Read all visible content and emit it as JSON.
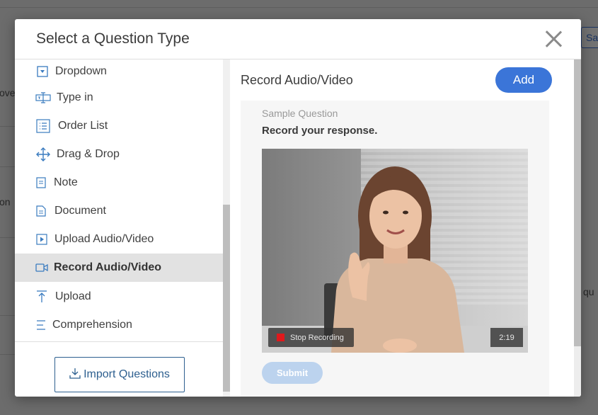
{
  "background": {
    "fragments": [
      "ove",
      "on",
      "Sa",
      "qu"
    ]
  },
  "modal": {
    "title": "Select a Question Type",
    "close_icon": "close-icon"
  },
  "question_types": [
    {
      "label": "Dropdown",
      "icon": "dropdown-icon"
    },
    {
      "label": "Type in",
      "icon": "type-in-icon"
    },
    {
      "label": "Order List",
      "icon": "order-list-icon"
    },
    {
      "label": "Drag & Drop",
      "icon": "drag-drop-icon"
    },
    {
      "label": "Note",
      "icon": "note-icon"
    },
    {
      "label": "Document",
      "icon": "document-icon"
    },
    {
      "label": "Upload Audio/Video",
      "icon": "upload-audio-video-icon"
    },
    {
      "label": "Record Audio/Video",
      "icon": "record-audio-video-icon",
      "selected": true
    },
    {
      "label": "Upload",
      "icon": "upload-icon"
    },
    {
      "label": "Comprehension",
      "icon": "comprehension-icon"
    }
  ],
  "import_button": {
    "label": "Import Questions",
    "icon": "download-icon"
  },
  "preview": {
    "title": "Record Audio/Video",
    "add_label": "Add",
    "sample_label": "Sample Question",
    "question_text": "Record your response.",
    "stop_recording_label": "Stop Recording",
    "timer": "2:19",
    "submit_label": "Submit"
  },
  "colors": {
    "accent": "#3b75d8",
    "icon_blue": "#3a7bbf",
    "record_red": "#e0191c",
    "selected_bg": "#e2e2e2"
  }
}
